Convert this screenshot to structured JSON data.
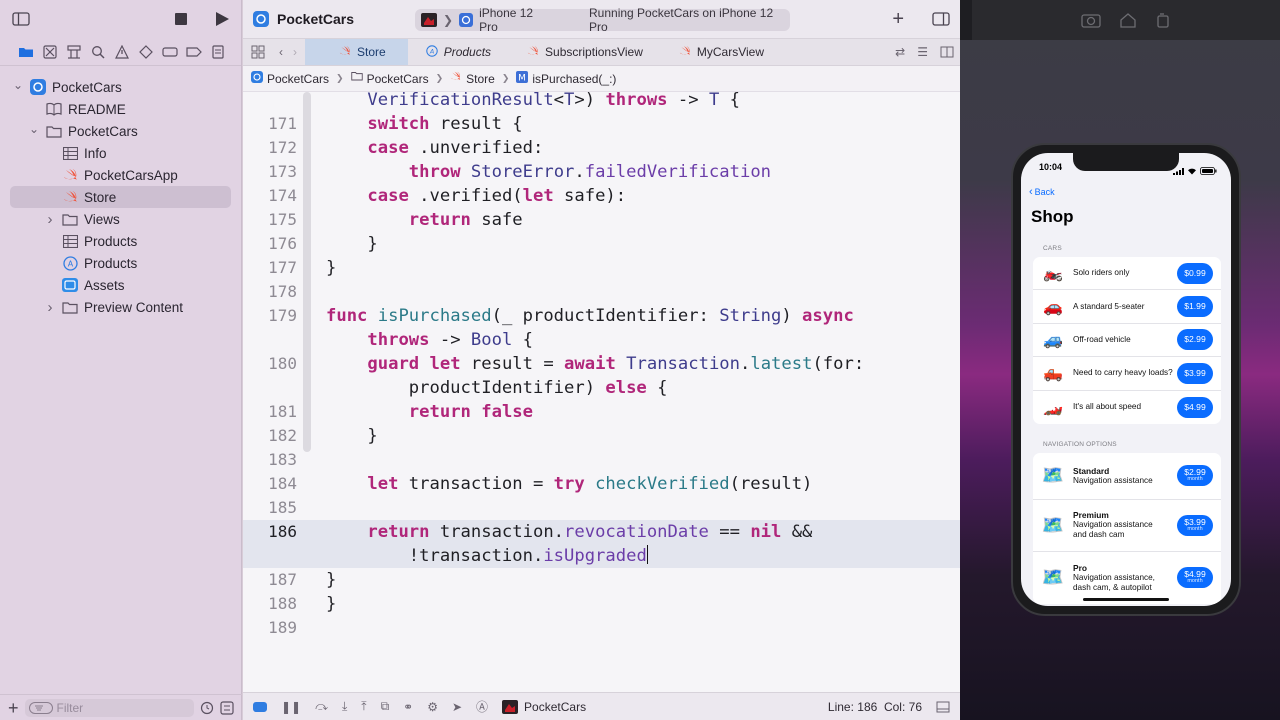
{
  "sidebar": {
    "tree": [
      {
        "label": "PocketCars",
        "icon": "app-project-icon",
        "indent": 0,
        "chevron": "open"
      },
      {
        "label": "README",
        "icon": "book-icon",
        "indent": 1,
        "chevron": ""
      },
      {
        "label": "PocketCars",
        "icon": "folder-icon",
        "indent": 1,
        "chevron": "open"
      },
      {
        "label": "Info",
        "icon": "table-icon",
        "indent": 2,
        "chevron": ""
      },
      {
        "label": "PocketCarsApp",
        "icon": "swift-icon",
        "indent": 2,
        "chevron": ""
      },
      {
        "label": "Store",
        "icon": "swift-icon",
        "indent": 2,
        "chevron": "",
        "selected": true
      },
      {
        "label": "Views",
        "icon": "folder-icon",
        "indent": 2,
        "chevron": "closed"
      },
      {
        "label": "Products",
        "icon": "table-icon",
        "indent": 2,
        "chevron": ""
      },
      {
        "label": "Products",
        "icon": "storekit-icon",
        "indent": 2,
        "chevron": ""
      },
      {
        "label": "Assets",
        "icon": "assets-icon",
        "indent": 2,
        "chevron": ""
      },
      {
        "label": "Preview Content",
        "icon": "folder-icon",
        "indent": 2,
        "chevron": "closed"
      }
    ],
    "filter_placeholder": "Filter"
  },
  "toolbar": {
    "app_title": "PocketCars",
    "device": "iPhone 12 Pro",
    "status": "Running PocketCars on iPhone 12 Pro"
  },
  "tabs": [
    {
      "label": "Store",
      "active": true,
      "italic": false,
      "icon": "swift-icon"
    },
    {
      "label": "Products",
      "active": false,
      "italic": true,
      "icon": "storekit-icon"
    },
    {
      "label": "SubscriptionsView",
      "active": false,
      "italic": false,
      "icon": "swift-icon"
    },
    {
      "label": "MyCarsView",
      "active": false,
      "italic": false,
      "icon": "swift-icon"
    }
  ],
  "jumpbar": [
    "PocketCars",
    "PocketCars",
    "Store",
    "isPurchased(_:)"
  ],
  "code": {
    "current_line": 186,
    "lines": [
      {
        "n": "",
        "t": "    VerificationResult<T>) throws -> T {"
      },
      {
        "n": "171",
        "t": "    switch result {"
      },
      {
        "n": "172",
        "t": "    case .unverified:"
      },
      {
        "n": "173",
        "t": "        throw StoreError.failedVerification"
      },
      {
        "n": "174",
        "t": "    case .verified(let safe):"
      },
      {
        "n": "175",
        "t": "        return safe"
      },
      {
        "n": "176",
        "t": "    }"
      },
      {
        "n": "177",
        "t": "}"
      },
      {
        "n": "178",
        "t": ""
      },
      {
        "n": "179",
        "t": "func isPurchased(_ productIdentifier: String) async"
      },
      {
        "n": "",
        "t": "    throws -> Bool {"
      },
      {
        "n": "180",
        "t": "    guard let result = await Transaction.latest(for:"
      },
      {
        "n": "",
        "t": "        productIdentifier) else {"
      },
      {
        "n": "181",
        "t": "        return false"
      },
      {
        "n": "182",
        "t": "    }"
      },
      {
        "n": "183",
        "t": ""
      },
      {
        "n": "184",
        "t": "    let transaction = try checkVerified(result)"
      },
      {
        "n": "185",
        "t": ""
      },
      {
        "n": "186",
        "t": "    return transaction.revocationDate == nil &&"
      },
      {
        "n": "",
        "t": "        !transaction.isUpgraded"
      },
      {
        "n": "187",
        "t": "}"
      },
      {
        "n": "188",
        "t": "}"
      },
      {
        "n": "189",
        "t": ""
      }
    ]
  },
  "statusbar": {
    "scheme": "PocketCars",
    "position": "Line: 186  Col: 76"
  },
  "simulator": {
    "time": "10:04",
    "back_label": "Back",
    "title": "Shop",
    "cars_header": "CARS",
    "cars": [
      {
        "emoji": "🏍️",
        "label": "Solo riders only",
        "price": "$0.99"
      },
      {
        "emoji": "🚗",
        "label": "A standard 5-seater",
        "price": "$1.99"
      },
      {
        "emoji": "🚙",
        "label": "Off-road vehicle",
        "price": "$2.99"
      },
      {
        "emoji": "🛻",
        "label": "Need to carry heavy loads?",
        "price": "$3.99"
      },
      {
        "emoji": "🏎️",
        "label": "It's all about speed",
        "price": "$4.99"
      }
    ],
    "nav_header": "NAVIGATION OPTIONS",
    "navigation": [
      {
        "emoji": "🗺️",
        "name": "Standard",
        "desc": "Navigation assistance",
        "price": "$2.99",
        "period": "month"
      },
      {
        "emoji": "🗺️",
        "name": "Premium",
        "desc": "Navigation assistance and dash cam",
        "price": "$3.99",
        "period": "month"
      },
      {
        "emoji": "🗺️",
        "name": "Pro",
        "desc": "Navigation assistance, dash cam, & autopilot",
        "price": "$4.99",
        "period": "month"
      }
    ]
  },
  "colors": {
    "accent": "#0a6cff",
    "keyword": "#b0267a",
    "sidebar_bg": "#e1d3e3"
  }
}
